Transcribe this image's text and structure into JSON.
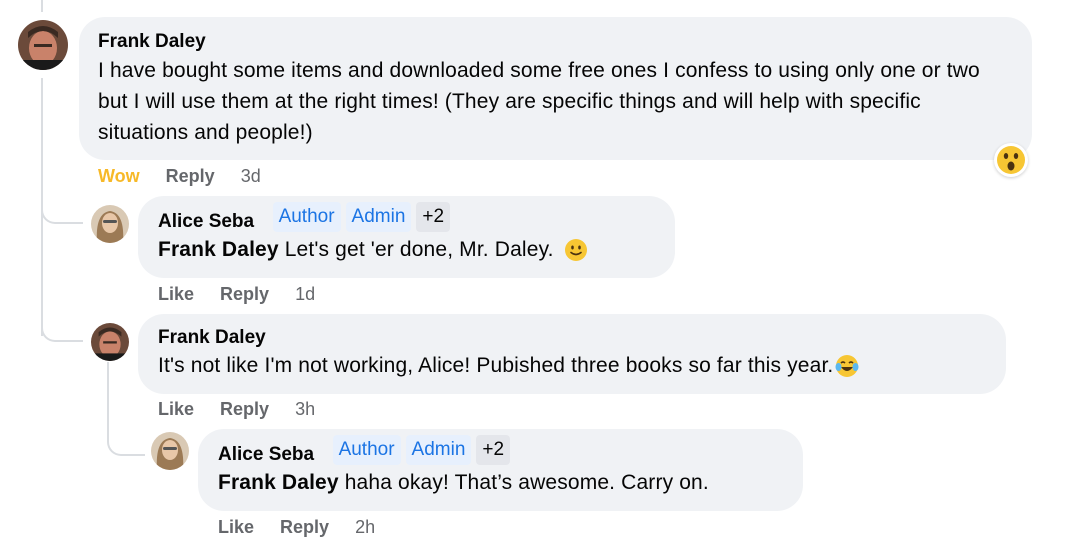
{
  "comments": [
    {
      "author": "Frank Daley",
      "text": "I have bought some items and downloaded some free ones I confess to using only one or two but I will use them at the right times! (They are specific things and will help with specific situations and people!)",
      "reaction_label": "Wow",
      "reply_label": "Reply",
      "time": "3d",
      "reaction_icon": "wow-emoji"
    },
    {
      "author": "Alice Seba",
      "badges": [
        "Author",
        "Admin",
        "+2"
      ],
      "mention": "Frank Daley",
      "text": "Let's get 'er done, Mr. Daley.",
      "emoji": "slightly-smiling-face",
      "like_label": "Like",
      "reply_label": "Reply",
      "time": "1d"
    },
    {
      "author": "Frank Daley",
      "text": "It's not like I'm not working, Alice! Pubished three books so far this year.",
      "emoji": "tears-of-joy-face",
      "like_label": "Like",
      "reply_label": "Reply",
      "time": "3h"
    },
    {
      "author": "Alice Seba",
      "badges": [
        "Author",
        "Admin",
        "+2"
      ],
      "mention": "Frank Daley",
      "text": "haha okay! That’s awesome. Carry on.",
      "like_label": "Like",
      "reply_label": "Reply",
      "time": "2h"
    }
  ],
  "colors": {
    "bubble": "#f0f2f5",
    "badge_text": "#1b74e4",
    "badge_bg": "#e7f0fd",
    "wow": "#f7b928",
    "meta": "#65676b"
  }
}
